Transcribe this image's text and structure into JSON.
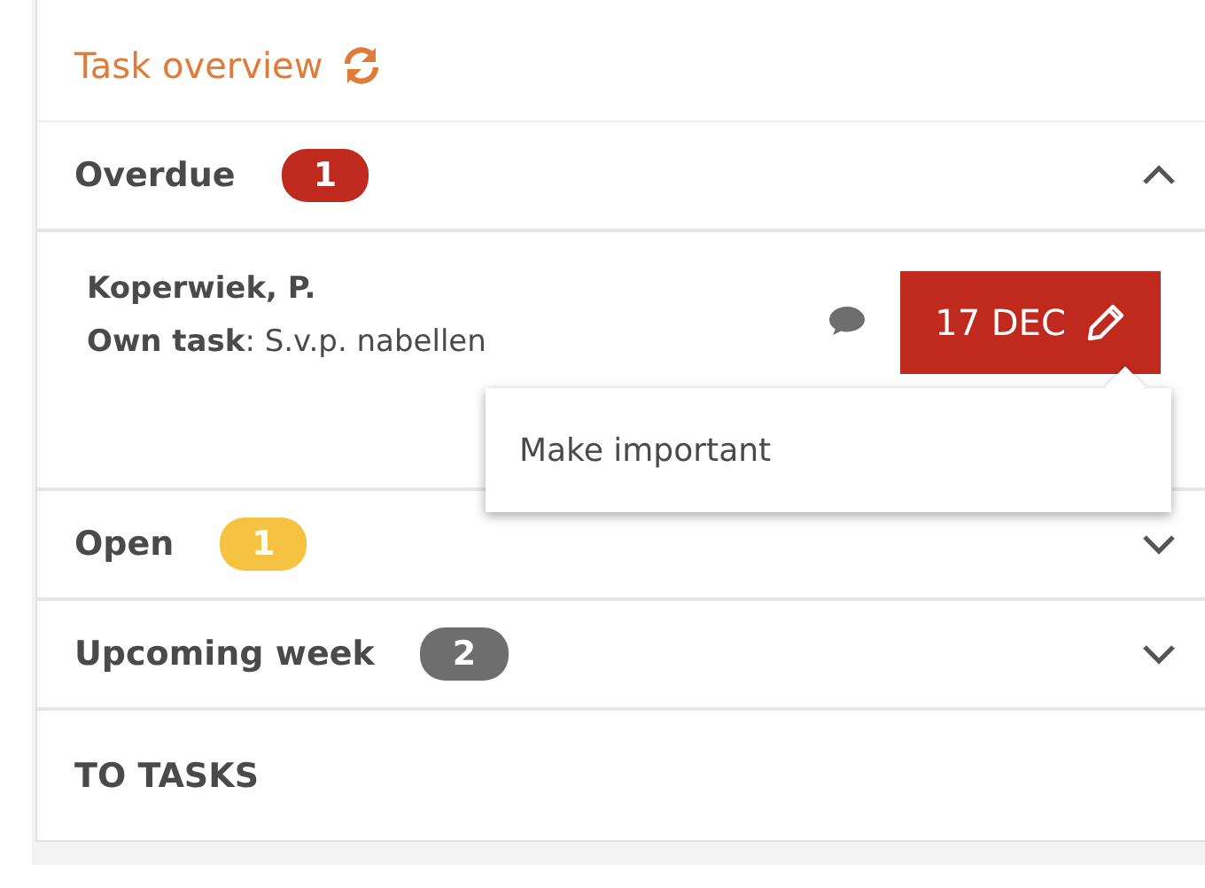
{
  "header": {
    "title": "Task overview"
  },
  "sections": [
    {
      "label": "Overdue",
      "count": "1",
      "color": "#c0291e",
      "expanded": true,
      "tasks": [
        {
          "name": "Koperwiek, P.",
          "description": "**Own task**: S.v.p. nabellen",
          "due": "17 DEC",
          "menu": {
            "items": [
              {
                "label": "Make important"
              }
            ]
          }
        }
      ]
    },
    {
      "label": "Open",
      "count": "1",
      "color": "#f5c242",
      "expanded": false
    },
    {
      "label": "Upcoming week",
      "count": "2",
      "color": "#6e6e6e",
      "expanded": false
    }
  ],
  "footer_link": "TO TASKS"
}
